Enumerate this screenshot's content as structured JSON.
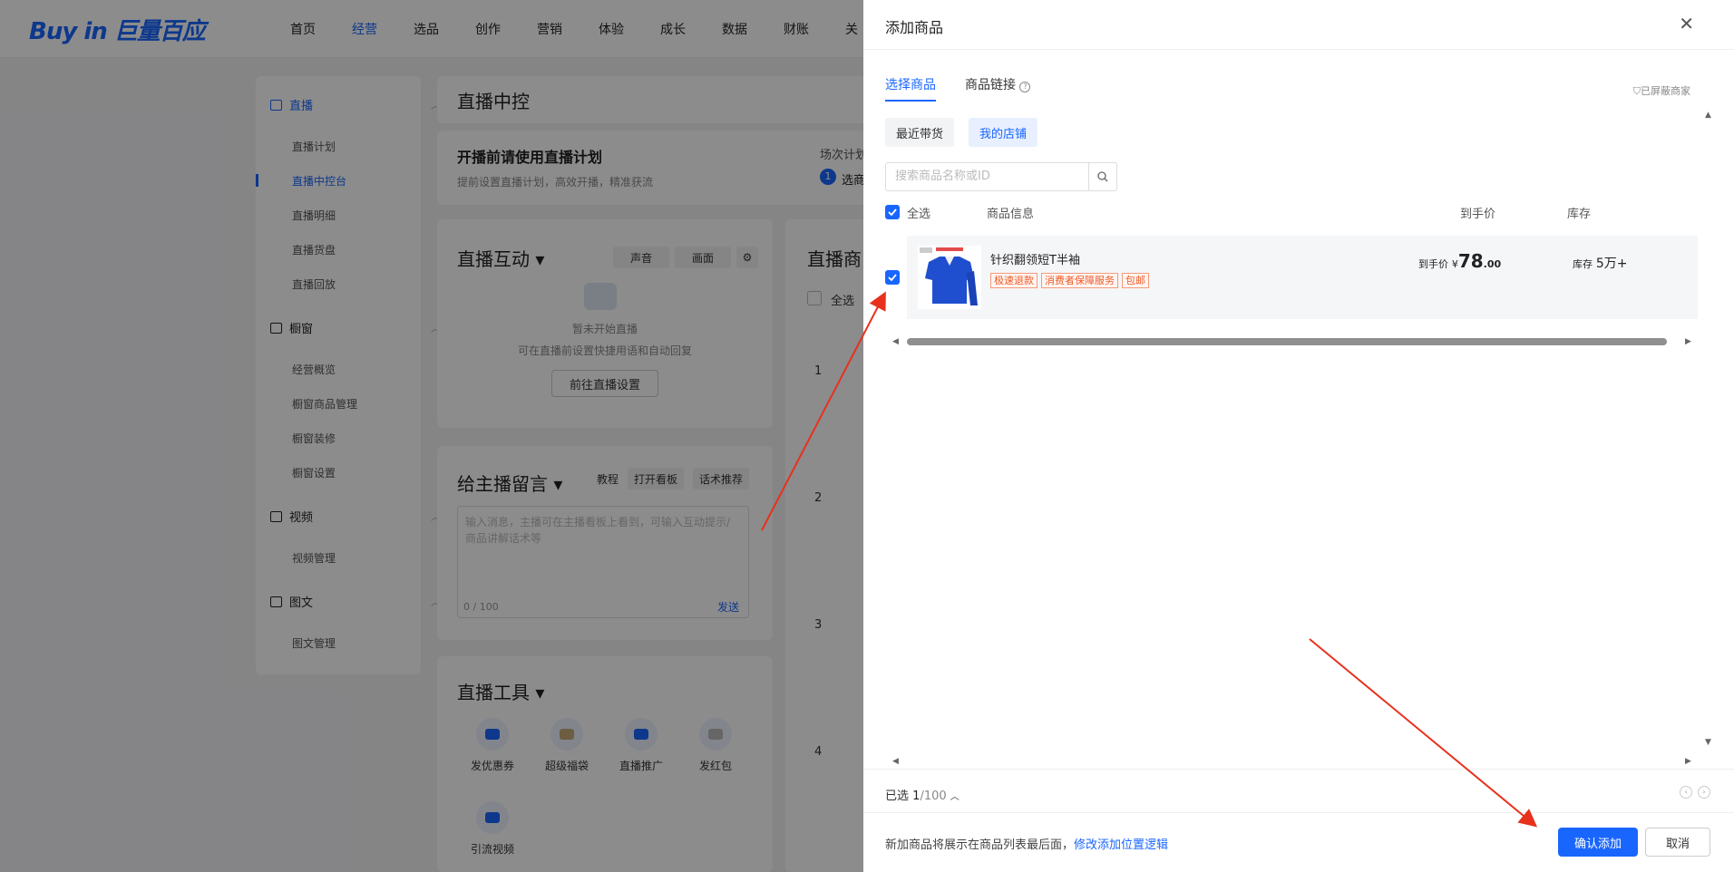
{
  "brand": {
    "logo": "Buy in 巨量百应"
  },
  "nav": [
    "首页",
    "经营",
    "选品",
    "创作",
    "营销",
    "体验",
    "成长",
    "数据",
    "财账",
    "关"
  ],
  "nav_active": "经营",
  "sidebar": {
    "groups": [
      {
        "label": "直播",
        "items": [
          "直播计划",
          "直播中控台",
          "直播明细",
          "直播货盘",
          "直播回放"
        ]
      },
      {
        "label": "橱窗",
        "items": [
          "经营概览",
          "橱窗商品管理",
          "橱窗装修",
          "橱窗设置"
        ]
      },
      {
        "label": "视频",
        "items": [
          "视频管理"
        ]
      },
      {
        "label": "图文",
        "items": [
          "图文管理"
        ]
      }
    ],
    "active_item": "直播中控台"
  },
  "main": {
    "page_title": "直播中控",
    "plan": {
      "title": "开播前请使用直播计划",
      "desc": "提前设置直播计划，高效开播，精准获流",
      "step_label": "场次计划",
      "step_num": "1",
      "step_text": "选商"
    },
    "interact": {
      "title": "直播互动 ▾",
      "sound": "声音",
      "picture": "画面",
      "empty": "暂未开始直播",
      "hint": "可在直播前设置快捷用语和自动回复",
      "goto": "前往直播设置"
    },
    "message": {
      "title": "给主播留言 ▾",
      "tutorial": "教程",
      "open_board": "打开看板",
      "script_rec": "话术推荐",
      "placeholder": "输入消息，主播可在主播看板上看到，可输入互动提示/商品讲解话术等",
      "counter": "0 / 100",
      "send": "发送"
    },
    "tools": {
      "title": "直播工具 ▾",
      "items": [
        "发优惠券",
        "超级福袋",
        "直播推广",
        "发红包",
        "引流视频"
      ]
    },
    "products": {
      "title": "直播商",
      "select_all": "全选",
      "rows": [
        "1",
        "2",
        "3",
        "4"
      ]
    }
  },
  "drawer": {
    "title": "添加商品",
    "tabs": [
      "选择商品",
      "商品链接"
    ],
    "blocked": "已屏蔽商家",
    "segments": [
      "最近带货",
      "我的店铺"
    ],
    "search_placeholder": "搜索商品名称或ID",
    "columns": {
      "select_all": "全选",
      "info": "商品信息",
      "price": "到手价",
      "stock": "库存"
    },
    "product": {
      "name": "针织翻领短T半袖",
      "tags": [
        "极速退款",
        "消费者保障服务",
        "包邮"
      ],
      "price_label": "到手价",
      "currency": "¥",
      "price_int": "78",
      "price_dec": ".00",
      "stock_label": "库存",
      "stock_value": "5万+"
    },
    "selected_label": "已选",
    "selected_count": "1",
    "selected_max": "/100",
    "note": "新加商品将展示在商品列表最后面，",
    "note_link": "修改添加位置逻辑",
    "confirm": "确认添加",
    "cancel": "取消"
  },
  "colors": {
    "accent": "#1966ff",
    "tag": "#f05a28",
    "annotation": "#e8311c"
  }
}
